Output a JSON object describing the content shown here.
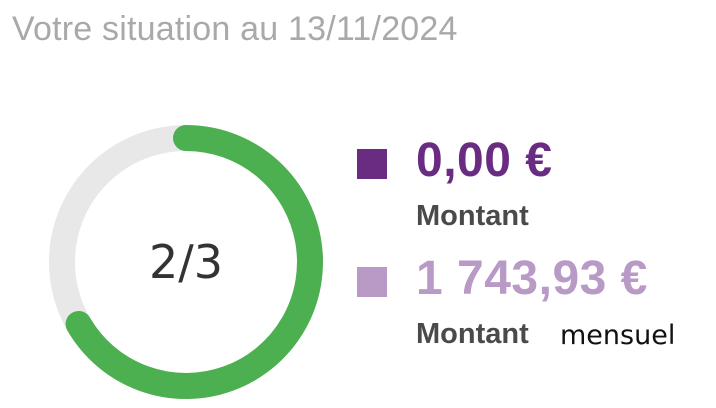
{
  "header": {
    "title": "Votre situation au 13/11/2024"
  },
  "gauge": {
    "label": "2/3",
    "progress": 0.6667,
    "progress_color": "#4caf50",
    "track_color": "#e8e8e8"
  },
  "legend": [
    {
      "amount": "0,00 €",
      "label": "Montant",
      "color": "#6a2c82"
    },
    {
      "amount": "1 743,93 €",
      "label": "Montant",
      "extra": "mensuel",
      "color": "#b99ac7"
    }
  ]
}
